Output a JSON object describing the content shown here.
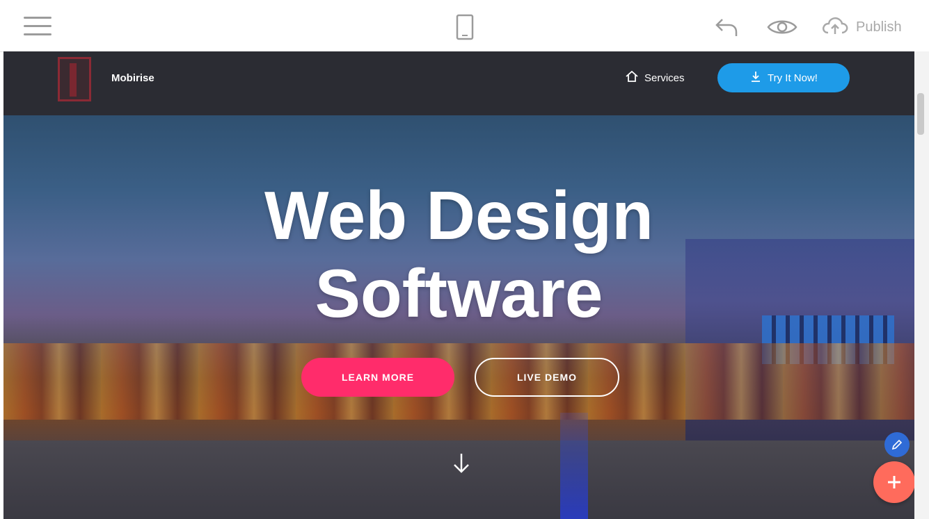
{
  "editor": {
    "menu_icon": "hamburger-icon",
    "device_icon": "mobile-device-icon",
    "undo_icon": "undo-icon",
    "preview_icon": "eye-icon",
    "publish": {
      "icon": "cloud-upload-icon",
      "label": "Publish"
    }
  },
  "site": {
    "brand": "Mobirise",
    "nav": {
      "services": {
        "icon": "home-icon",
        "label": "Services"
      },
      "cta": {
        "icon": "download-icon",
        "label": "Try It Now!"
      }
    },
    "hero": {
      "title_line1": "Web Design",
      "title_line2": "Software",
      "primary_button": "LEARN MORE",
      "secondary_button": "LIVE DEMO",
      "scroll_icon": "arrow-down-icon"
    },
    "floating": {
      "small_icon": "edit-icon",
      "big_icon": "add-icon"
    }
  },
  "colors": {
    "primary_button": "#ff2c6b",
    "cta": "#1e9be8",
    "navbar": "#2b2c33",
    "fab_big": "#ff6b5c",
    "fab_small": "#2f6bd6"
  }
}
